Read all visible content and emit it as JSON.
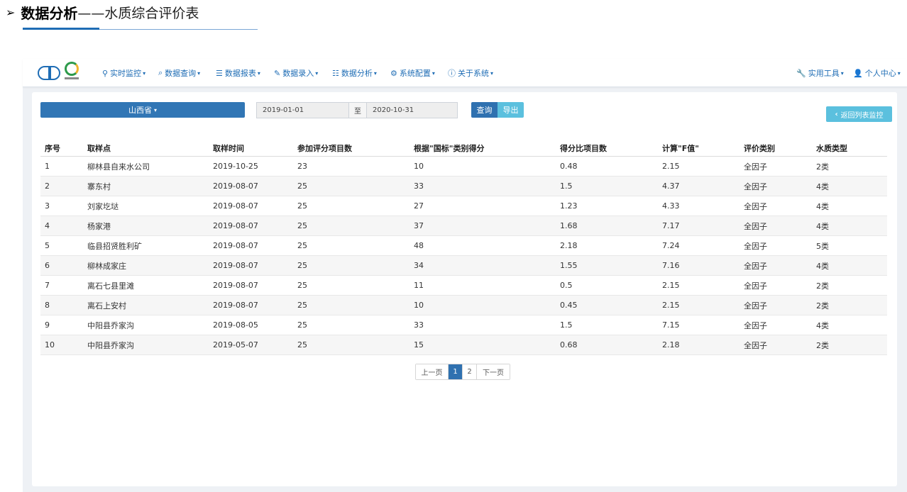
{
  "heading": {
    "arrow": "➢",
    "bold": "数据分析",
    "rest": "——水质综合评价表"
  },
  "nav": {
    "items": [
      {
        "icon": "map-marker-icon",
        "glyph": "⚲",
        "label": "实时监控"
      },
      {
        "icon": "search-icon",
        "glyph": "⌕",
        "label": "数据查询"
      },
      {
        "icon": "list-icon",
        "glyph": "☰",
        "label": "数据报表"
      },
      {
        "icon": "edit-icon",
        "glyph": "✎",
        "label": "数据录入"
      },
      {
        "icon": "tasks-icon",
        "glyph": "☷",
        "label": "数据分析"
      },
      {
        "icon": "gear-icon",
        "glyph": "⚙",
        "label": "系统配置"
      },
      {
        "icon": "info-icon",
        "glyph": "ⓘ",
        "label": "关于系统"
      }
    ],
    "right_items": [
      {
        "icon": "wrench-icon",
        "glyph": "🔧",
        "label": "实用工具"
      },
      {
        "icon": "user-icon",
        "glyph": "👤",
        "label": "个人中心"
      }
    ],
    "caret": "▾"
  },
  "filters": {
    "province": "山西省",
    "start_date": "2019-01-01",
    "separator": "至",
    "end_date": "2020-10-31",
    "query_label": "查询",
    "export_label": "导出",
    "back_label": "返回列表监控",
    "back_icon": "‹"
  },
  "table": {
    "headers": [
      "序号",
      "取样点",
      "取样时间",
      "参加评分项目数",
      "根据\"国标\"类别得分",
      "得分比项目数",
      "计算\"F值\"",
      "评价类别",
      "水质类型"
    ],
    "rows": [
      [
        "1",
        "柳林县自来水公司",
        "2019-10-25",
        "23",
        "10",
        "0.48",
        "2.15",
        "全因子",
        "2类"
      ],
      [
        "2",
        "寨东村",
        "2019-08-07",
        "25",
        "33",
        "1.5",
        "4.37",
        "全因子",
        "4类"
      ],
      [
        "3",
        "刘家圪垯",
        "2019-08-07",
        "25",
        "27",
        "1.23",
        "4.33",
        "全因子",
        "4类"
      ],
      [
        "4",
        "杨家港",
        "2019-08-07",
        "25",
        "37",
        "1.68",
        "7.17",
        "全因子",
        "4类"
      ],
      [
        "5",
        "临县招贤胜利矿",
        "2019-08-07",
        "25",
        "48",
        "2.18",
        "7.24",
        "全因子",
        "5类"
      ],
      [
        "6",
        "柳林成家庄",
        "2019-08-07",
        "25",
        "34",
        "1.55",
        "7.16",
        "全因子",
        "4类"
      ],
      [
        "7",
        "离石七县里滩",
        "2019-08-07",
        "25",
        "11",
        "0.5",
        "2.15",
        "全因子",
        "2类"
      ],
      [
        "8",
        "离石上安村",
        "2019-08-07",
        "25",
        "10",
        "0.45",
        "2.15",
        "全因子",
        "2类"
      ],
      [
        "9",
        "中阳县乔家沟",
        "2019-08-05",
        "25",
        "33",
        "1.5",
        "7.15",
        "全因子",
        "4类"
      ],
      [
        "10",
        "中阳县乔家沟",
        "2019-05-07",
        "25",
        "15",
        "0.68",
        "2.18",
        "全因子",
        "2类"
      ]
    ]
  },
  "pager": {
    "prev": "上一页",
    "pages": [
      "1",
      "2"
    ],
    "current": "1",
    "next": "下一页"
  },
  "colors": {
    "primary": "#2f71b0",
    "info": "#5bc0de",
    "nav_text": "#1f6db5"
  }
}
